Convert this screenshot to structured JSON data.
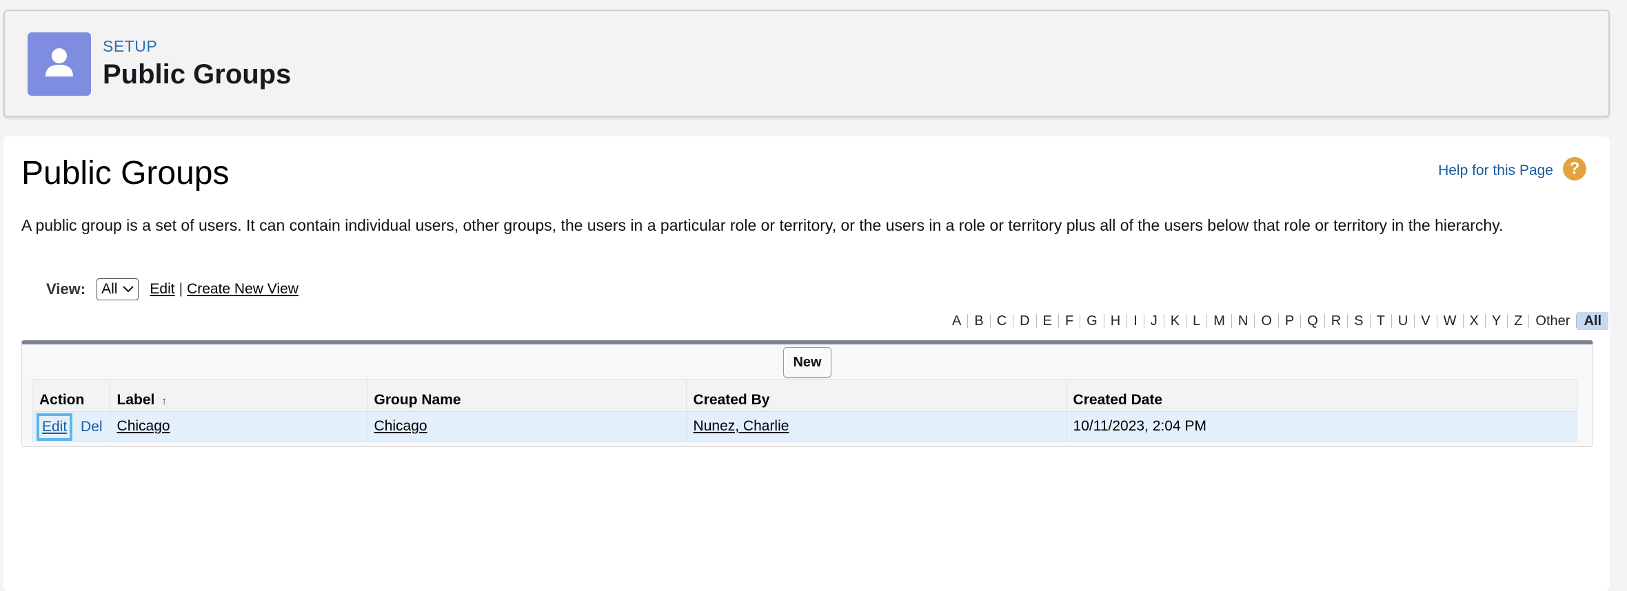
{
  "header": {
    "setup_label": "SETUP",
    "title": "Public Groups",
    "icon": "user-icon",
    "icon_color": "#7f8de1"
  },
  "page": {
    "title": "Public Groups",
    "help_link": "Help for this Page",
    "help_icon": "?",
    "description": "A public group is a set of users. It can contain individual users, other groups, the users in a particular role or territory, or the users in a role or territory plus all of the users below that role or territory in the hierarchy."
  },
  "view": {
    "label": "View:",
    "selected": "All",
    "edit_link": "Edit",
    "separator": "|",
    "create_link": "Create New View"
  },
  "alphabet": [
    "A",
    "B",
    "C",
    "D",
    "E",
    "F",
    "G",
    "H",
    "I",
    "J",
    "K",
    "L",
    "M",
    "N",
    "O",
    "P",
    "Q",
    "R",
    "S",
    "T",
    "U",
    "V",
    "W",
    "X",
    "Y",
    "Z",
    "Other",
    "All"
  ],
  "alphabet_active": "All",
  "toolbar": {
    "new_label": "New"
  },
  "table": {
    "columns": [
      "Action",
      "Label",
      "Group Name",
      "Created By",
      "Created Date"
    ],
    "rows": [
      {
        "edit": "Edit",
        "del": "Del",
        "label": "Chicago",
        "group_name": "Chicago",
        "created_by": "Nunez, Charlie",
        "created_date": "10/11/2023, 2:04 PM"
      }
    ]
  }
}
